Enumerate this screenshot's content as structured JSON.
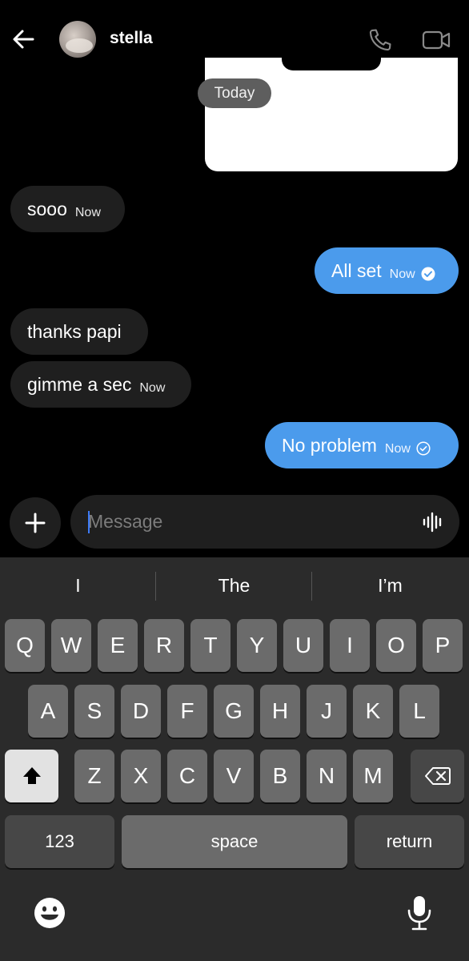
{
  "header": {
    "contact_name": "stella",
    "back_icon": "arrow-left-icon",
    "call_icon": "phone-icon",
    "video_icon": "video-camera-icon"
  },
  "chat": {
    "date_separator": "Today",
    "messages": [
      {
        "direction": "in",
        "text": "sooo",
        "time": "Now"
      },
      {
        "direction": "out",
        "text": "All set",
        "time": "Now",
        "status": "read"
      },
      {
        "direction": "in",
        "text": "thanks papi",
        "time": ""
      },
      {
        "direction": "in",
        "text": "gimme a sec",
        "time": "Now"
      },
      {
        "direction": "out",
        "text": "No problem",
        "time": "Now",
        "status": "sent"
      }
    ]
  },
  "composer": {
    "placeholder": "Message",
    "value": ""
  },
  "keyboard": {
    "suggestions": [
      "I",
      "The",
      "I’m"
    ],
    "row1": [
      "Q",
      "W",
      "E",
      "R",
      "T",
      "Y",
      "U",
      "I",
      "O",
      "P"
    ],
    "row2": [
      "A",
      "S",
      "D",
      "F",
      "G",
      "H",
      "J",
      "K",
      "L"
    ],
    "row3": [
      "Z",
      "X",
      "C",
      "V",
      "B",
      "N",
      "M"
    ],
    "numbers_label": "123",
    "space_label": "space",
    "return_label": "return"
  },
  "colors": {
    "outgoing_bubble": "#4b9bec",
    "incoming_bubble": "#1f1f1f",
    "background": "#000000",
    "keyboard_bg": "#2b2b2b",
    "key": "#6b6b6b"
  }
}
